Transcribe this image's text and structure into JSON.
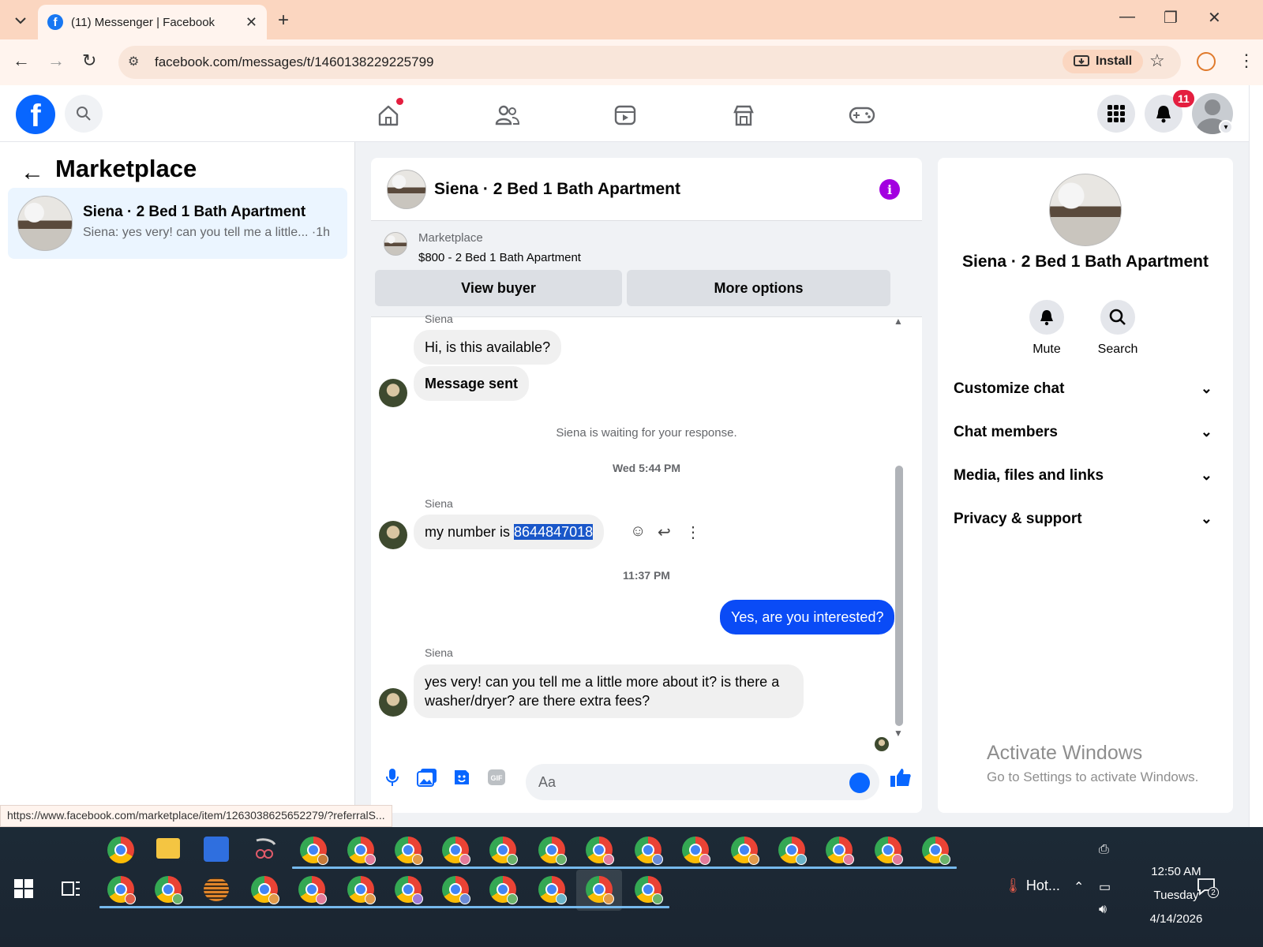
{
  "browser": {
    "tab_title": "(11) Messenger | Facebook",
    "url": "facebook.com/messages/t/1460138229225799",
    "install_label": "Install",
    "status_url": "https://www.facebook.com/marketplace/item/1263038625652279/?referralS..."
  },
  "fbnav": {
    "notification_count": "11",
    "logo_letter": "f"
  },
  "left": {
    "title": "Marketplace",
    "conversation": {
      "name": "Siena · 2 Bed 1 Bath Apartment",
      "preview": "Siena: yes very! can you tell me a little... ·1h"
    }
  },
  "chat": {
    "header_name": "Siena · 2 Bed 1 Bath Apartment",
    "info_glyph": "i",
    "marketplace_label": "Marketplace",
    "listing": "$800 - 2 Bed 1 Bath Apartment",
    "view_buyer": "View buyer",
    "more_options": "More options",
    "messages": {
      "sender1": "Siena",
      "m1": "Hi, is this available?",
      "m2": "Message sent",
      "waiting": "Siena is waiting for your response.",
      "time1": "Wed 5:44 PM",
      "sender2": "Siena",
      "m3_prefix": "my number is ",
      "m3_number": "8644847018",
      "time2": "11:37 PM",
      "m4": "Yes, are you interested?",
      "sender3": "Siena",
      "m5_line1": "yes very! can you tell me a little more about it? is there a",
      "m5_line2": "washer/dryer? are there extra fees?"
    },
    "input_placeholder": "Aa"
  },
  "right": {
    "name": "Siena · 2 Bed 1 Bath Apartment",
    "mute": "Mute",
    "search": "Search",
    "sections": [
      "Customize chat",
      "Chat members",
      "Media, files and links",
      "Privacy & support"
    ],
    "activate_title": "Activate Windows",
    "activate_sub": "Go to Settings to activate Windows."
  },
  "taskbar": {
    "time": "12:50 AM",
    "day": "Tuesday",
    "date": "4/14/2026",
    "weather": "Hot...",
    "notif_count": "2"
  }
}
